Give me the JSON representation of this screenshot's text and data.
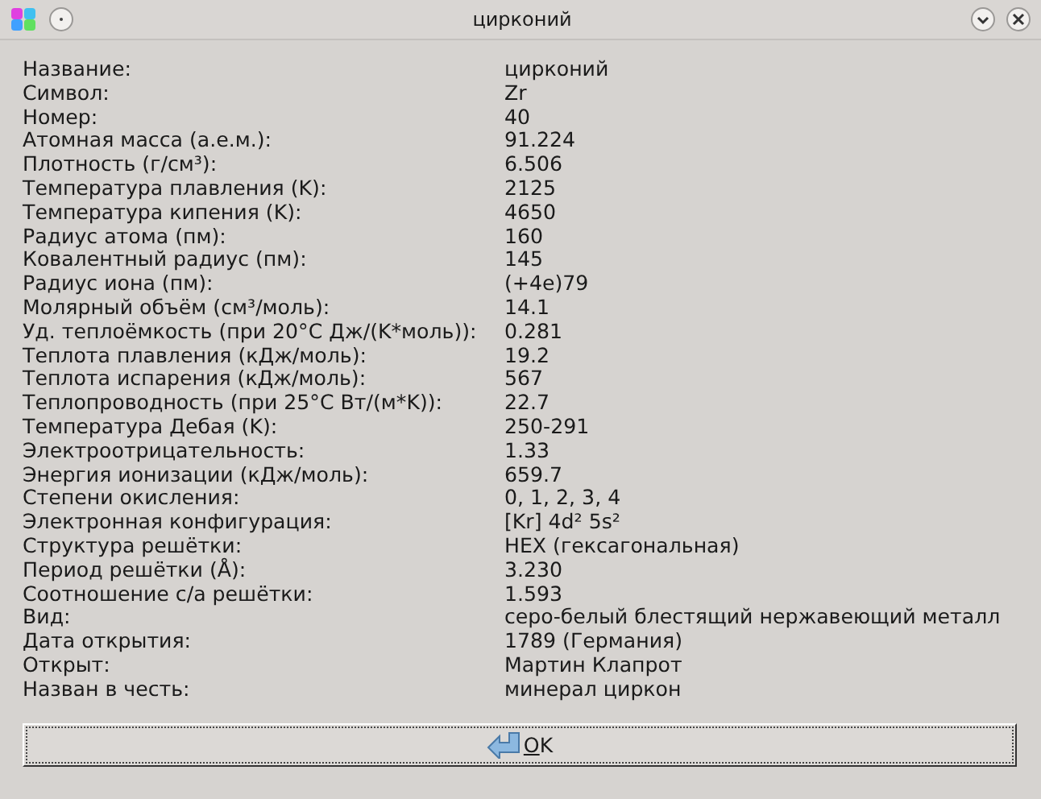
{
  "window": {
    "title": "цирконий"
  },
  "properties": [
    {
      "label": "Название:",
      "value": "цирконий"
    },
    {
      "label": "Символ:",
      "value": "Zr"
    },
    {
      "label": "Номер:",
      "value": "40"
    },
    {
      "label": "Атомная масса (а.е.м.):",
      "value": "91.224"
    },
    {
      "label": "Плотность (г/см³):",
      "value": "6.506"
    },
    {
      "label": "Температура плавления (K):",
      "value": "2125"
    },
    {
      "label": "Температура кипения (K):",
      "value": "4650"
    },
    {
      "label": "Радиус атома (пм):",
      "value": "160"
    },
    {
      "label": "Ковалентный радиус (пм):",
      "value": "145"
    },
    {
      "label": "Радиус иона (пм):",
      "value": "(+4e)79"
    },
    {
      "label": "Молярный объём (см³/моль):",
      "value": "14.1"
    },
    {
      "label": "Уд. теплоёмкость (при 20°C Дж/(K*моль)):",
      "value": "0.281"
    },
    {
      "label": "Теплота плавления (кДж/моль):",
      "value": "19.2"
    },
    {
      "label": "Теплота испарения (кДж/моль):",
      "value": "567"
    },
    {
      "label": "Теплопроводность (при 25°C Вт/(м*K)):",
      "value": "22.7"
    },
    {
      "label": "Температура Дебая (K):",
      "value": "250-291"
    },
    {
      "label": "Электроотрицательность:",
      "value": "1.33"
    },
    {
      "label": "Энергия ионизации (кДж/моль):",
      "value": "659.7"
    },
    {
      "label": "Степени окисления:",
      "value": "0, 1, 2, 3, 4"
    },
    {
      "label": "Электронная конфигурация:",
      "value": "[Kr] 4d² 5s²"
    },
    {
      "label": "Структура решётки:",
      "value": "HEX (гексагональная)"
    },
    {
      "label": "Период решётки (Å):",
      "value": "3.230"
    },
    {
      "label": "Соотношение c/a решётки:",
      "value": "1.593"
    },
    {
      "label": "Вид:",
      "value": "серо-белый блестящий нержавеющий металл"
    },
    {
      "label": "Дата открытия:",
      "value": "1789 (Германия)"
    },
    {
      "label": "Открыт:",
      "value": "Мартин Клапрот"
    },
    {
      "label": "Назван в честь:",
      "value": "минерал циркон"
    }
  ],
  "ok_button": {
    "label": "OK"
  }
}
